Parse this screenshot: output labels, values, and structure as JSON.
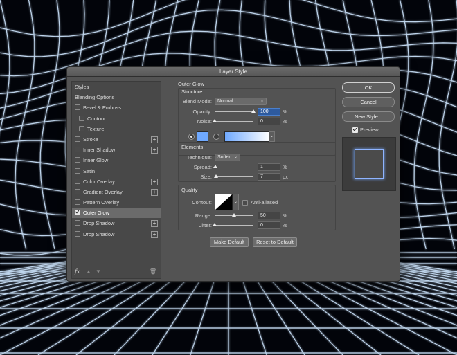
{
  "dialog": {
    "title": "Layer Style"
  },
  "left_panel": {
    "items": [
      {
        "label": "Styles",
        "type": "header",
        "checked": false,
        "plus": false
      },
      {
        "label": "Blending Options",
        "type": "header",
        "checked": false,
        "plus": false
      },
      {
        "label": "Bevel & Emboss",
        "type": "item",
        "checked": false,
        "plus": false
      },
      {
        "label": "Contour",
        "type": "sub",
        "checked": false,
        "plus": false
      },
      {
        "label": "Texture",
        "type": "sub",
        "checked": false,
        "plus": false
      },
      {
        "label": "Stroke",
        "type": "item",
        "checked": false,
        "plus": true
      },
      {
        "label": "Inner Shadow",
        "type": "item",
        "checked": false,
        "plus": true
      },
      {
        "label": "Inner Glow",
        "type": "item",
        "checked": false,
        "plus": false
      },
      {
        "label": "Satin",
        "type": "item",
        "checked": false,
        "plus": false
      },
      {
        "label": "Color Overlay",
        "type": "item",
        "checked": false,
        "plus": true
      },
      {
        "label": "Gradient Overlay",
        "type": "item",
        "checked": false,
        "plus": true
      },
      {
        "label": "Pattern Overlay",
        "type": "item",
        "checked": false,
        "plus": false
      },
      {
        "label": "Outer Glow",
        "type": "item",
        "checked": true,
        "plus": false,
        "selected": true
      },
      {
        "label": "Drop Shadow",
        "type": "item",
        "checked": false,
        "plus": true
      },
      {
        "label": "Drop Shadow",
        "type": "item",
        "checked": false,
        "plus": true
      }
    ],
    "fx_label": "fx"
  },
  "outer_glow": {
    "title": "Outer Glow",
    "structure": {
      "title": "Structure",
      "blend_mode_label": "Blend Mode:",
      "blend_mode": "Normal",
      "opacity_label": "Opacity:",
      "opacity": "100",
      "opacity_unit": "%",
      "opacity_fraction": 1.0,
      "noise_label": "Noise:",
      "noise": "0",
      "noise_unit": "%",
      "noise_fraction": 0.0,
      "glow_color": "#6fa9ff"
    },
    "elements": {
      "title": "Elements",
      "technique_label": "Technique:",
      "technique": "Softer",
      "spread_label": "Spread:",
      "spread": "1",
      "spread_unit": "%",
      "spread_fraction": 0.01,
      "size_label": "Size:",
      "size": "7",
      "size_unit": "px",
      "size_fraction": 0.03
    },
    "quality": {
      "title": "Quality",
      "contour_label": "Contour:",
      "anti_aliased_label": "Anti-aliased",
      "anti_aliased": false,
      "range_label": "Range:",
      "range": "50",
      "range_unit": "%",
      "range_fraction": 0.5,
      "jitter_label": "Jitter:",
      "jitter": "0",
      "jitter_unit": "%",
      "jitter_fraction": 0.0
    },
    "make_default_label": "Make Default",
    "reset_default_label": "Reset to Default"
  },
  "right_panel": {
    "ok_label": "OK",
    "cancel_label": "Cancel",
    "new_style_label": "New Style...",
    "preview_label": "Preview",
    "preview_checked": true
  },
  "colors": {
    "accent": "#6fa9ff",
    "grid_line": "#bfe0ff",
    "dialog_bg": "#535353"
  }
}
